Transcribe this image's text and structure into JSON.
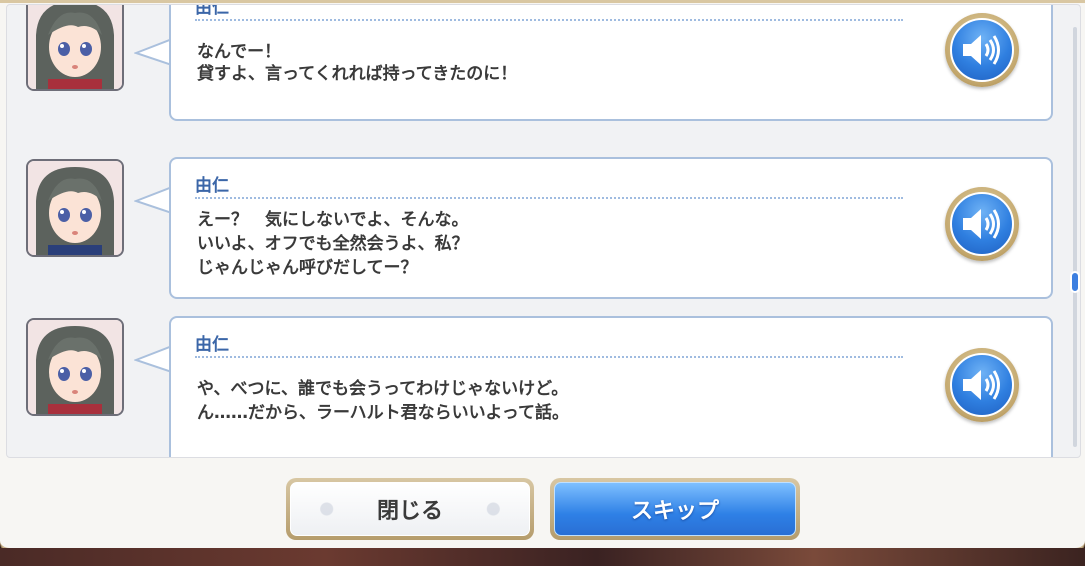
{
  "dialogue_log": {
    "entries": [
      {
        "speaker": "由仁",
        "lines": [
          "なんでー！",
          "貸すよ、言ってくれれば持ってきたのに！"
        ]
      },
      {
        "speaker": "由仁",
        "lines": [
          "えー？　気にしないでよ、そんな。",
          "いいよ、オフでも全然会うよ、私？",
          "じゃんじゃん呼びだしてー？"
        ]
      },
      {
        "speaker": "由仁",
        "lines": [
          "や、べつに、誰でも会うってわけじゃないけど。",
          "ん……だから、ラーハルト君ならいいよって話。"
        ]
      }
    ],
    "voice_icon": "speaker-volume-icon"
  },
  "buttons": {
    "close_label": "閉じる",
    "skip_label": "スキップ"
  },
  "colors": {
    "speaker_name": "#3b66a8",
    "accent_blue": "#2f7fe0",
    "frame_gold": "#c2a66c"
  }
}
